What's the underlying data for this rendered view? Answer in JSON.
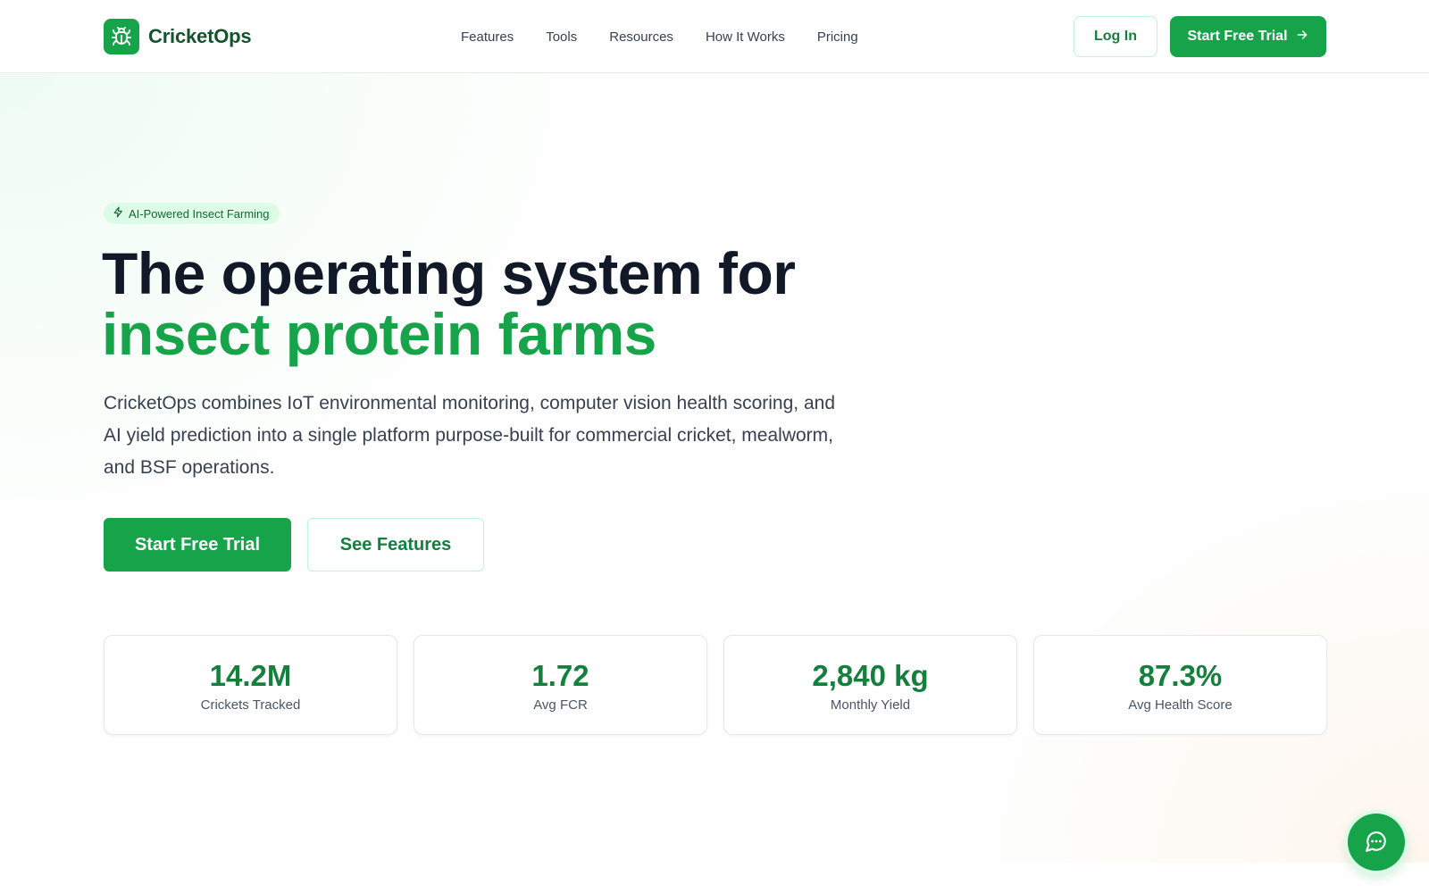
{
  "header": {
    "brand_name": "CricketOps",
    "brand_icon": "bug-icon",
    "nav": [
      {
        "label": "Features"
      },
      {
        "label": "Tools"
      },
      {
        "label": "Resources"
      },
      {
        "label": "How It Works"
      },
      {
        "label": "Pricing"
      }
    ],
    "login_label": "Log In",
    "trial_label": "Start Free Trial",
    "trial_icon": "arrow-right-icon"
  },
  "hero": {
    "badge_icon": "lightning-icon",
    "badge_text": "AI-Powered Insect Farming",
    "headline_line1": "The operating system for",
    "headline_line2": "insect protein farms",
    "lede": "CricketOps combines IoT environmental monitoring, computer vision health scoring, and AI yield prediction into a single platform purpose-built for commercial cricket, mealworm, and BSF operations.",
    "primary_cta": "Start Free Trial",
    "secondary_cta": "See Features"
  },
  "stats": [
    {
      "value": "14.2M",
      "label": "Crickets Tracked"
    },
    {
      "value": "1.72",
      "label": "Avg FCR"
    },
    {
      "value": "2,840 kg",
      "label": "Monthly Yield"
    },
    {
      "value": "87.3%",
      "label": "Avg Health Score"
    }
  ],
  "chat": {
    "icon": "chat-bubble-icon"
  },
  "colors": {
    "brand_green": "#16a34a",
    "dark_green": "#14532d",
    "text_dark": "#111827",
    "badge_bg": "#dcfce7"
  }
}
